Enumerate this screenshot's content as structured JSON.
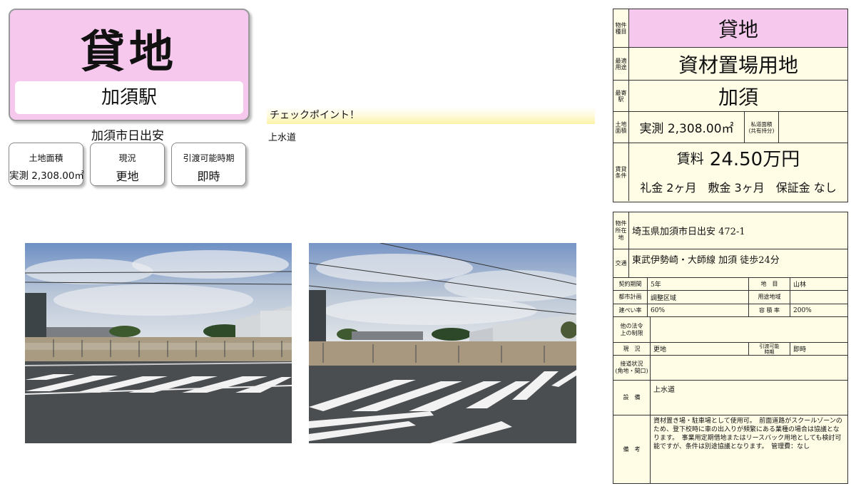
{
  "header": {
    "title": "貸地",
    "station": "加須駅",
    "address_short": "加須市日出安"
  },
  "info_boxes": [
    {
      "label": "土地面積",
      "value": "実測 2,308.00㎡"
    },
    {
      "label": "現況",
      "value": "更地"
    },
    {
      "label": "引渡可能時期",
      "value": "即時"
    }
  ],
  "checkpoint": {
    "heading": "チェックポイント！",
    "items": [
      "上水道"
    ]
  },
  "photos": [
    {
      "alt": "land-photo-1"
    },
    {
      "alt": "land-photo-2"
    }
  ],
  "summary_table": {
    "type_label": "物件種目",
    "type_value": "貸地",
    "use_label": "最適用途",
    "use_value": "資材置場用地",
    "station_label": "最寄駅",
    "station_value": "加須",
    "area_label": "土地面積",
    "area_value": "実測 2,308.00㎡",
    "private_road_label": "私道面積\n(共有持分)",
    "lease_label": "賃貸条件",
    "rent_prefix": "賃料",
    "rent_value": "24.50万円",
    "conditions": "礼金 2ヶ月　敷金 3ヶ月　保証金 なし"
  },
  "detail_table": {
    "location_label": "物件所在地",
    "location_value": "埼玉県加須市日出安 472-1",
    "traffic_label": "交通",
    "traffic_value": "東武伊勢崎・大師線 加須 徒歩24分",
    "contract_label": "契約期間",
    "contract_value": "5年",
    "chimoku_label": "地　目",
    "chimoku_value": "山林",
    "city_plan_label": "都市計画",
    "city_plan_value": "調整区域",
    "zoning_label": "用途地域",
    "zoning_value": "",
    "bcr_label": "建ぺい率",
    "bcr_value": "60%",
    "far_label": "容 積 率",
    "far_value": "200%",
    "other_law_label": "他の法令\n上の制限",
    "other_law_value": "",
    "status_label": "現　況",
    "status_value": "更地",
    "handover_label": "引渡可能\n時期",
    "handover_value": "即時",
    "road_label": "接道状況\n(角地・間口)",
    "road_value": "",
    "facilities_label": "設　備",
    "facilities_value": "上水道",
    "remarks_label": "備　考",
    "remarks_value": "資材置き場・駐車場として使用可。　前面道路がスクールゾーンのため、登下校時に車の出入りが頻繁にある業種の場合は協議となります。　事業用定期借地またはリースバック用地としても検討可能ですが、条件は別途協議となります。　管理費：なし"
  },
  "colors": {
    "title_pink": "#f6c8ee",
    "table_cream": "#fffde6",
    "checkpoint_yellow": "#fbf3a8"
  }
}
